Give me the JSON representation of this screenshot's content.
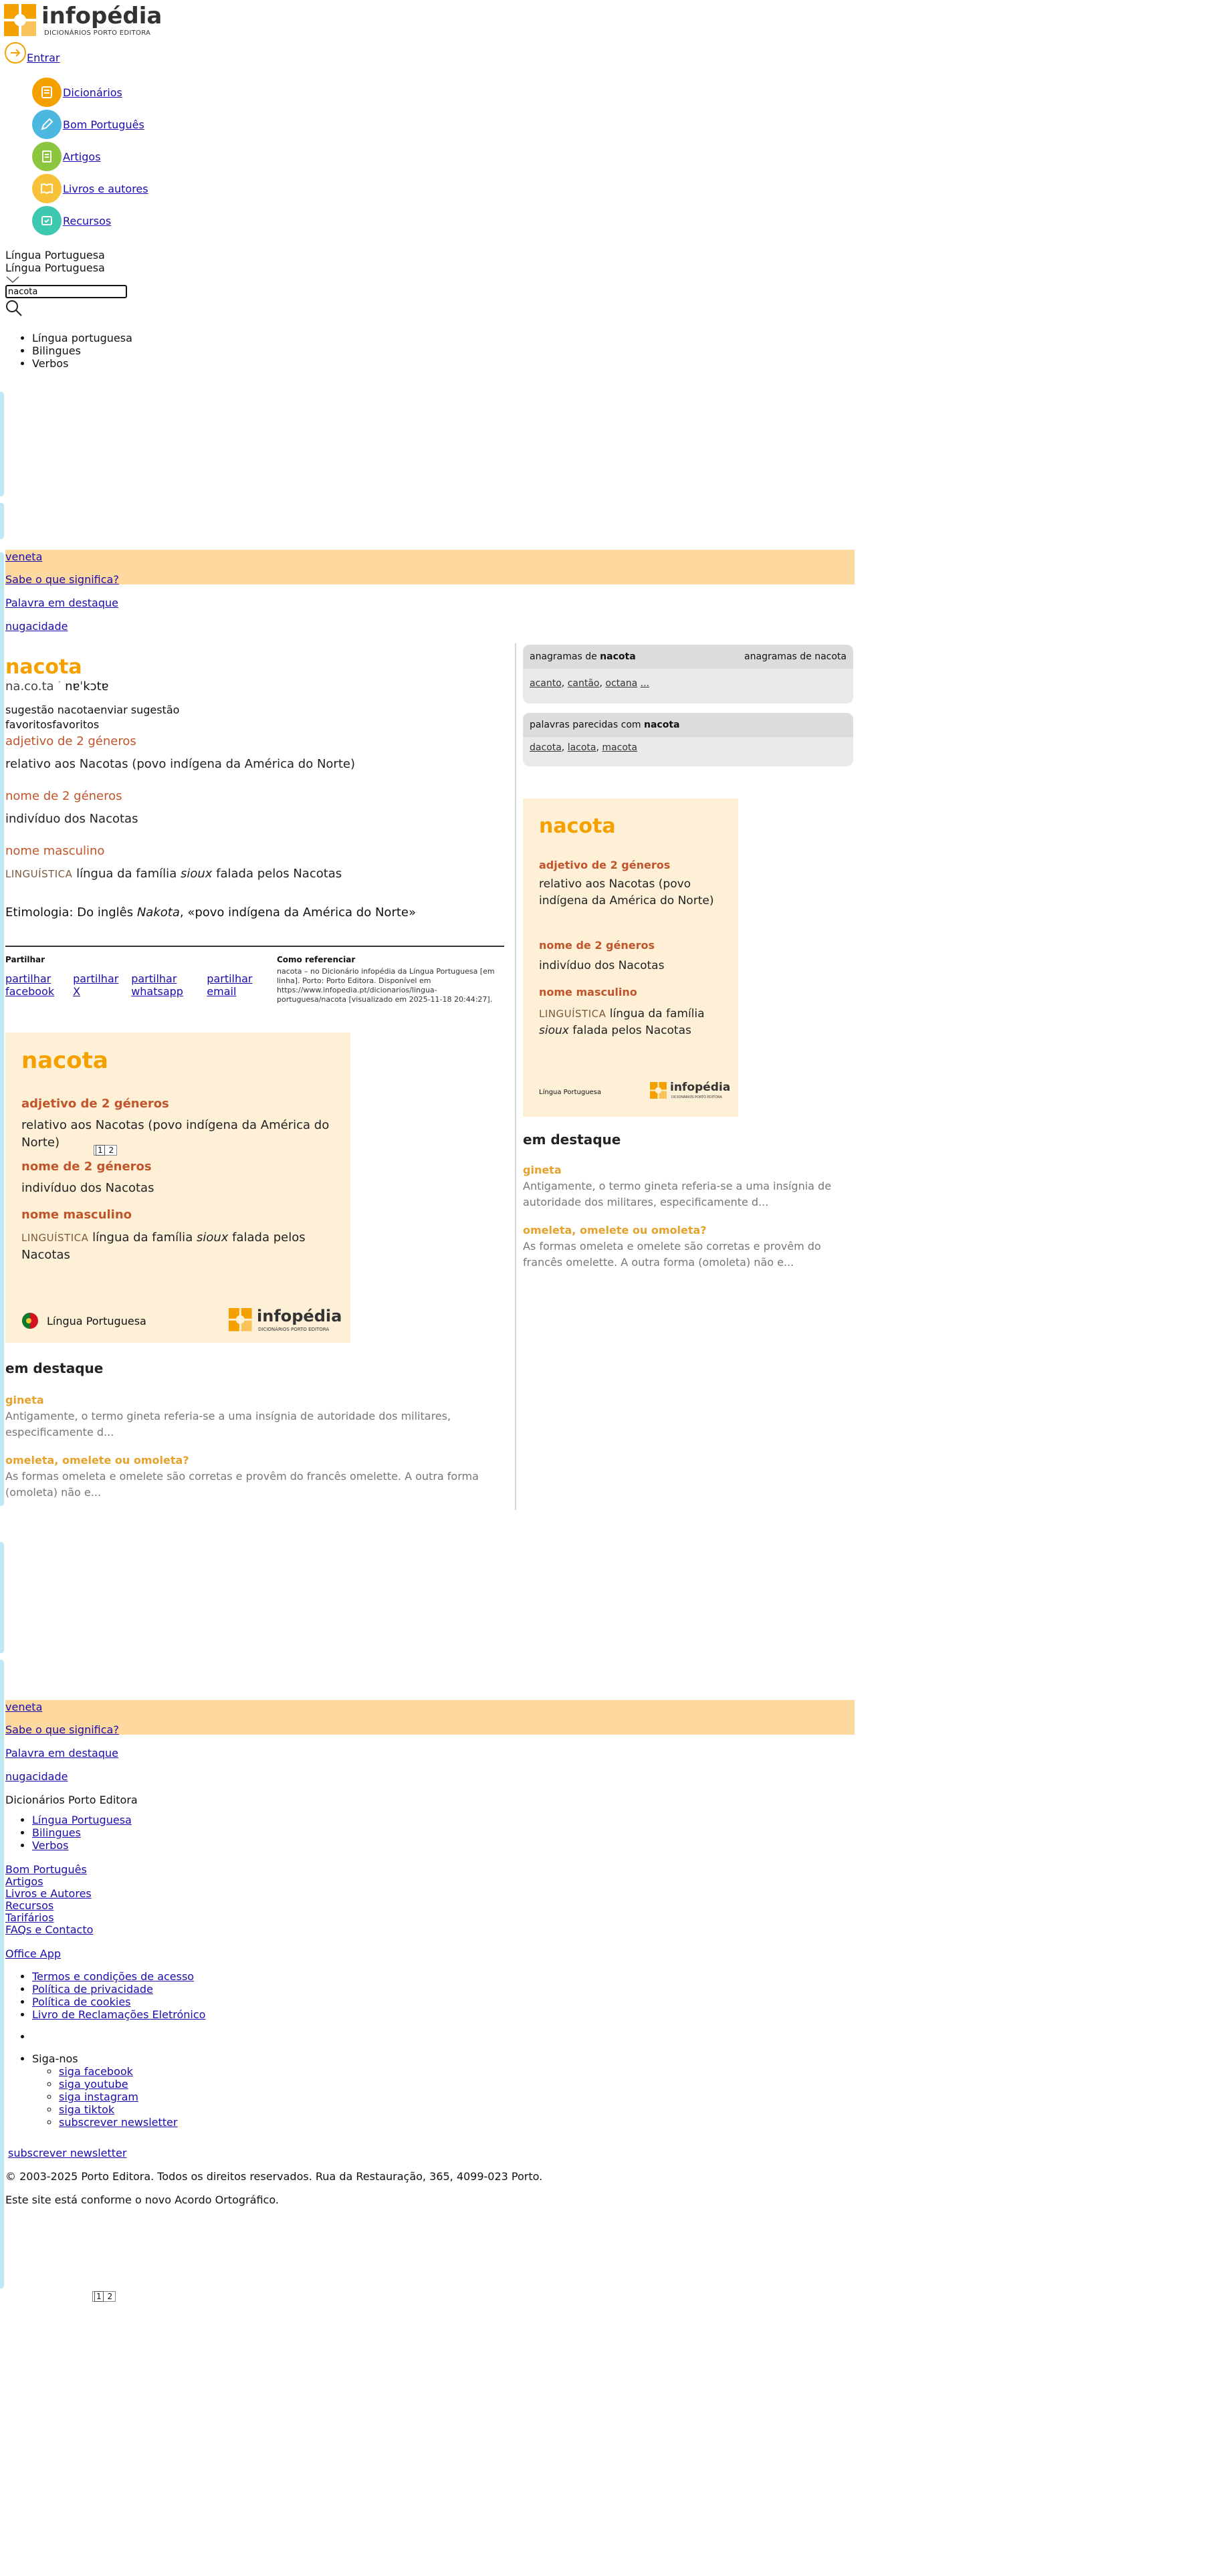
{
  "brand": {
    "name": "infopédia",
    "tagline": "DICIONÁRIOS PORTO EDITORA",
    "colors": {
      "orange": "#f4a100",
      "cream": "#fdf0d7",
      "band": "#fdd9a0"
    }
  },
  "header": {
    "login_label": "Entrar",
    "nav": [
      {
        "label": "Dicionários",
        "icon": "books-icon",
        "color": "#f4a100"
      },
      {
        "label": "Bom Português",
        "icon": "edit-icon",
        "color": "#4cb8e0"
      },
      {
        "label": "Artigos",
        "icon": "document-icon",
        "color": "#8cc63f"
      },
      {
        "label": "Livros e autores",
        "icon": "book-icon",
        "color": "#f7c23a"
      },
      {
        "label": "Recursos",
        "icon": "resources-icon",
        "color": "#3ec8b0"
      }
    ],
    "dictionary_selected": "Língua Portuguesa",
    "dictionary_selected_2": "Língua Portuguesa",
    "search_value": "nacota",
    "search_options": [
      "Língua portuguesa",
      "Bilingues",
      "Verbos"
    ]
  },
  "feature_band": {
    "word": "veneta",
    "question": "Sabe o que significa?",
    "highlight_label": "Palavra em destaque",
    "highlight_word": "nugacidade"
  },
  "entry": {
    "headword": "nacota",
    "syllabification": "na.co.ta",
    "pronunciation": "nɐˈkɔtɐ",
    "suggestion_alt": "sugestão nacota",
    "suggestion_label": "enviar sugestão",
    "favorites_alt": "favoritos",
    "favorites_label": "favoritos",
    "senses": [
      {
        "gram": "adjetivo de 2 géneros",
        "def": "relativo aos Nacotas (povo indígena da América do Norte)"
      },
      {
        "gram": "nome de 2 géneros",
        "def": "indivíduo dos Nacotas"
      },
      {
        "gram": "nome masculino",
        "domain": "LINGUÍSTICA",
        "def_pre": "língua da família ",
        "def_em": "sioux",
        "def_post": " falada pelos Nacotas"
      }
    ],
    "etymology_pre": "Etimologia: Do inglês ",
    "etymology_em": "Nakota",
    "etymology_post": ", «povo indígena da América do Norte»"
  },
  "share": {
    "title": "Partilhar",
    "items": [
      "partilhar facebook",
      "partilhar X",
      "partilhar whatsapp",
      "partilhar email"
    ],
    "cite_title": "Como referenciar",
    "cite_text": "nacota – no Dicionário infopédia da Língua Portuguesa [em linha]. Porto: Porto Editora. Disponível em https://www.infopedia.pt/dicionarios/lingua-portuguesa/nacota [visualizado em 2025-11-18 20:44:27]."
  },
  "card": {
    "headword": "nacota",
    "footer_label": "Língua Portuguesa",
    "logo_text": "infopédia",
    "logo_sub": "DICIONÁRIOS PORTO EDITORA",
    "pager": [
      "1",
      "2"
    ]
  },
  "featured": {
    "title": "em destaque",
    "items": [
      {
        "title": "gineta",
        "text": "Antigamente, o termo gineta referia-se a uma insígnia de autoridade dos militares, especificamente d..."
      },
      {
        "title": "omeleta, omelete ou omoleta?",
        "text": "As formas omeleta e omelete são corretas e provêm do francês omelette. A outra forma (omoleta) não e..."
      }
    ]
  },
  "sidebar": {
    "anagrams_pre": "anagramas de ",
    "anagrams_word": "nacota",
    "anagrams_img_alt": "anagramas de nacota",
    "anagrams": [
      "acanto",
      "cantão",
      "octana",
      "..."
    ],
    "similar_pre": "palavras parecidas com ",
    "similar_word": "nacota",
    "similar": [
      "dacota",
      "lacota",
      "macota"
    ]
  },
  "footer": {
    "section_title": "Dicionários Porto Editora",
    "dict_links": [
      "Língua Portuguesa",
      "Bilingues",
      "Verbos"
    ],
    "links": [
      "Bom Português",
      "Artigos",
      "Livros e Autores",
      "Recursos",
      "Tarifários",
      "FAQs e Contacto"
    ],
    "office_app": "Office App",
    "legal": [
      "Termos e condições de acesso",
      "Política de privacidade",
      "Política de cookies",
      "Livro de Reclamações Eletrónico"
    ],
    "follow_label": "Siga-nos",
    "social": [
      "siga facebook",
      "siga youtube",
      "siga instagram",
      "siga tiktok"
    ],
    "newsletter": "subscrever newsletter",
    "newsletter_2": "subscrever newsletter",
    "copyright": "© 2003-2025 Porto Editora. Todos os direitos reservados. Rua da Restauração, 365, 4099-023 Porto.",
    "ao_note": "Este site está conforme o novo Acordo Ortográfico.",
    "pager": [
      "1",
      "2"
    ]
  }
}
